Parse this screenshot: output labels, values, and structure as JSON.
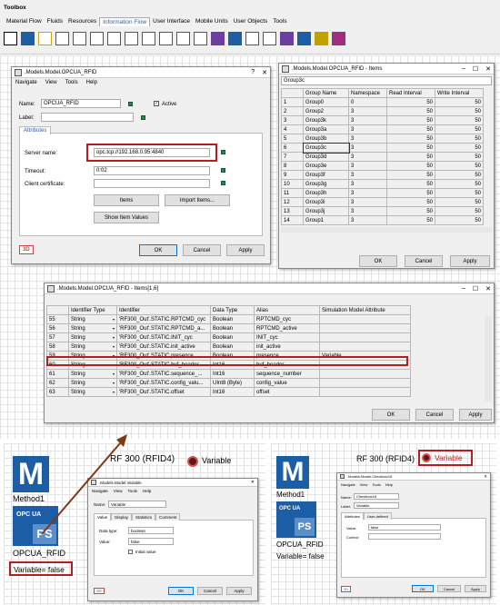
{
  "toolbox": {
    "title": "Toolbox",
    "tabs": [
      "Material Flow",
      "Fluids",
      "Resources",
      "Information Flow",
      "User Interface",
      "Mobile Units",
      "User Objects",
      "Tools"
    ],
    "active_tab": "Information Flow"
  },
  "tools": [
    "arrow-tool",
    "method-tool",
    "variable-tool",
    "table-tool",
    "card-file-tool",
    "trigger-tool",
    "generator-tool",
    "time-sequence-tool",
    "sql-tool",
    "socket-tool",
    "interface-tool",
    "file-interface-tool",
    "opcua-plus-tool",
    "plc-plus-tool",
    "xml-tool",
    "network-tool",
    "ps-plus-tool",
    "ps-plus-2-tool",
    "ps-plus-3-tool",
    "ps-plus-4-tool"
  ],
  "rfid_dialog": {
    "title": ".Models.Model.OPCUA_RFID",
    "menu": [
      "Navigate",
      "View",
      "Tools",
      "Help"
    ],
    "name_label": "Name:",
    "name_value": "OPCUA_RFID",
    "label_label": "Label:",
    "active_label": "Active",
    "tab": "Attributes",
    "server_label": "Server name:",
    "server_value": "opc.tcp://192.168.0.95:4840",
    "timeout_label": "Timeout:",
    "timeout_value": "0:02",
    "cert_label": "Client certificate:",
    "items_btn": "Items",
    "import_btn": "Import Items...",
    "show_btn": "Show Item Values",
    "badge": "3D",
    "ok": "OK",
    "cancel": "Cancel",
    "apply": "Apply",
    "help": "?"
  },
  "items_dialog": {
    "title": ".Models.Model.OPCUA_RFID - Items",
    "selected": "Group3c",
    "headers": [
      "Group Name",
      "Namespace",
      "Read Interval",
      "Write Interval"
    ],
    "rows": [
      [
        "1",
        "Group0",
        "0",
        "50",
        "50"
      ],
      [
        "2",
        "Group2",
        "3",
        "50",
        "50"
      ],
      [
        "3",
        "Group3k",
        "3",
        "50",
        "50"
      ],
      [
        "4",
        "Group3a",
        "3",
        "50",
        "50"
      ],
      [
        "5",
        "Group3b",
        "3",
        "50",
        "50"
      ],
      [
        "6",
        "Group3c",
        "3",
        "50",
        "50"
      ],
      [
        "7",
        "Group3d",
        "3",
        "50",
        "50"
      ],
      [
        "8",
        "Group3e",
        "3",
        "50",
        "50"
      ],
      [
        "9",
        "Group3f",
        "3",
        "50",
        "50"
      ],
      [
        "10",
        "Group3g",
        "3",
        "50",
        "50"
      ],
      [
        "11",
        "Group3h",
        "3",
        "50",
        "50"
      ],
      [
        "12",
        "Group3i",
        "3",
        "50",
        "50"
      ],
      [
        "13",
        "Group3j",
        "3",
        "50",
        "50"
      ],
      [
        "14",
        "Group1",
        "3",
        "50",
        "50"
      ]
    ],
    "ok": "OK",
    "cancel": "Cancel",
    "apply": "Apply"
  },
  "items16": {
    "title": ".Models.Model.OPCUA_RFID - Items[1,6]",
    "headers": [
      "Identifier Type",
      "Identifier",
      "Data Type",
      "Alias",
      "Simulation Model Attribute"
    ],
    "rows": [
      [
        "55",
        "String",
        "'RF300_Out'.STATIC.RPTCMD_cyc",
        "Boolean",
        "RPTCMD_cyc",
        ""
      ],
      [
        "56",
        "String",
        "'RF300_Out'.STATIC.RPTCMD_a...",
        "Boolean",
        "RPTCMD_active",
        ""
      ],
      [
        "57",
        "String",
        "'RF300_Out'.STATIC.INIT_cyc",
        "Boolean",
        "INIT_cyc",
        ""
      ],
      [
        "58",
        "String",
        "'RF300_Out'.STATIC.init_active",
        "Boolean",
        "init_active",
        ""
      ],
      [
        "59",
        "String",
        "'RF300_Out'.STATIC.presence",
        "Boolean",
        "presence",
        "Variable"
      ],
      [
        "60",
        "String",
        "'RF300_Out'.STATIC.buf_header",
        "Int16",
        "buf_header",
        ""
      ],
      [
        "61",
        "String",
        "'RF300_Out'.STATIC.sequence_...",
        "Int16",
        "sequence_number",
        ""
      ],
      [
        "62",
        "String",
        "'RF300_Out'.STATIC.config_valu...",
        "UInt8 (Byte)",
        "config_value",
        ""
      ],
      [
        "63",
        "String",
        "'RF300_Out'.STATIC.offset",
        "Int16",
        "offset",
        ""
      ]
    ],
    "ok": "OK",
    "cancel": "Cancel",
    "apply": "Apply"
  },
  "left_panel": {
    "method_label": "Method1",
    "opcua_text": "OPC UA",
    "ps_text": "PS",
    "opcua_label": "OPCUA_RFID",
    "variable_text": "Variable= false",
    "rf_text": "RF 300 (RFID4)",
    "var_label": "Variable"
  },
  "var_dialog": {
    "title": ".Models.Model.Variable",
    "menu": [
      "Navigate",
      "View",
      "Tools",
      "Help"
    ],
    "name_label": "Name:",
    "name_value": "Variable",
    "tabs": [
      "Value",
      "Display",
      "Statistics",
      "Comment"
    ],
    "dtype_label": "Data type:",
    "dtype_value": "boolean",
    "value_label": "Value:",
    "value_value": "false",
    "init_label": "Initial value",
    "badge": "3D",
    "ok": "OK",
    "cancel": "Cancel",
    "apply": "Apply"
  },
  "right_panel": {
    "method_label": "Method1",
    "opcua_text": "OPC UA",
    "ps_text": "PS",
    "opcua_label": "OPCUA_RFID",
    "variable_text": "Variable= false",
    "rf_text": "RF 300 (RFID4)",
    "var_label": "Variable"
  },
  "cb_dialog": {
    "title": ".Models.Model.Checkbox15",
    "menu": [
      "Navigate",
      "View",
      "Tools",
      "Help"
    ],
    "name_label": "Name:",
    "name_value": "Checkbox15",
    "label_label": "Label:",
    "label_value": "Variable",
    "tabs": [
      "Attributes",
      "User-defined"
    ],
    "value_label": "Value:",
    "value_value": "false",
    "control_label": "Control:",
    "badge": "3D",
    "ok": "OK",
    "cancel": "Cancel",
    "apply": "Apply"
  },
  "colors": {
    "accent": "#0078d7",
    "highlight": "#b21f23",
    "method": "#1c5ea6",
    "arrow": "#7a3a18"
  }
}
